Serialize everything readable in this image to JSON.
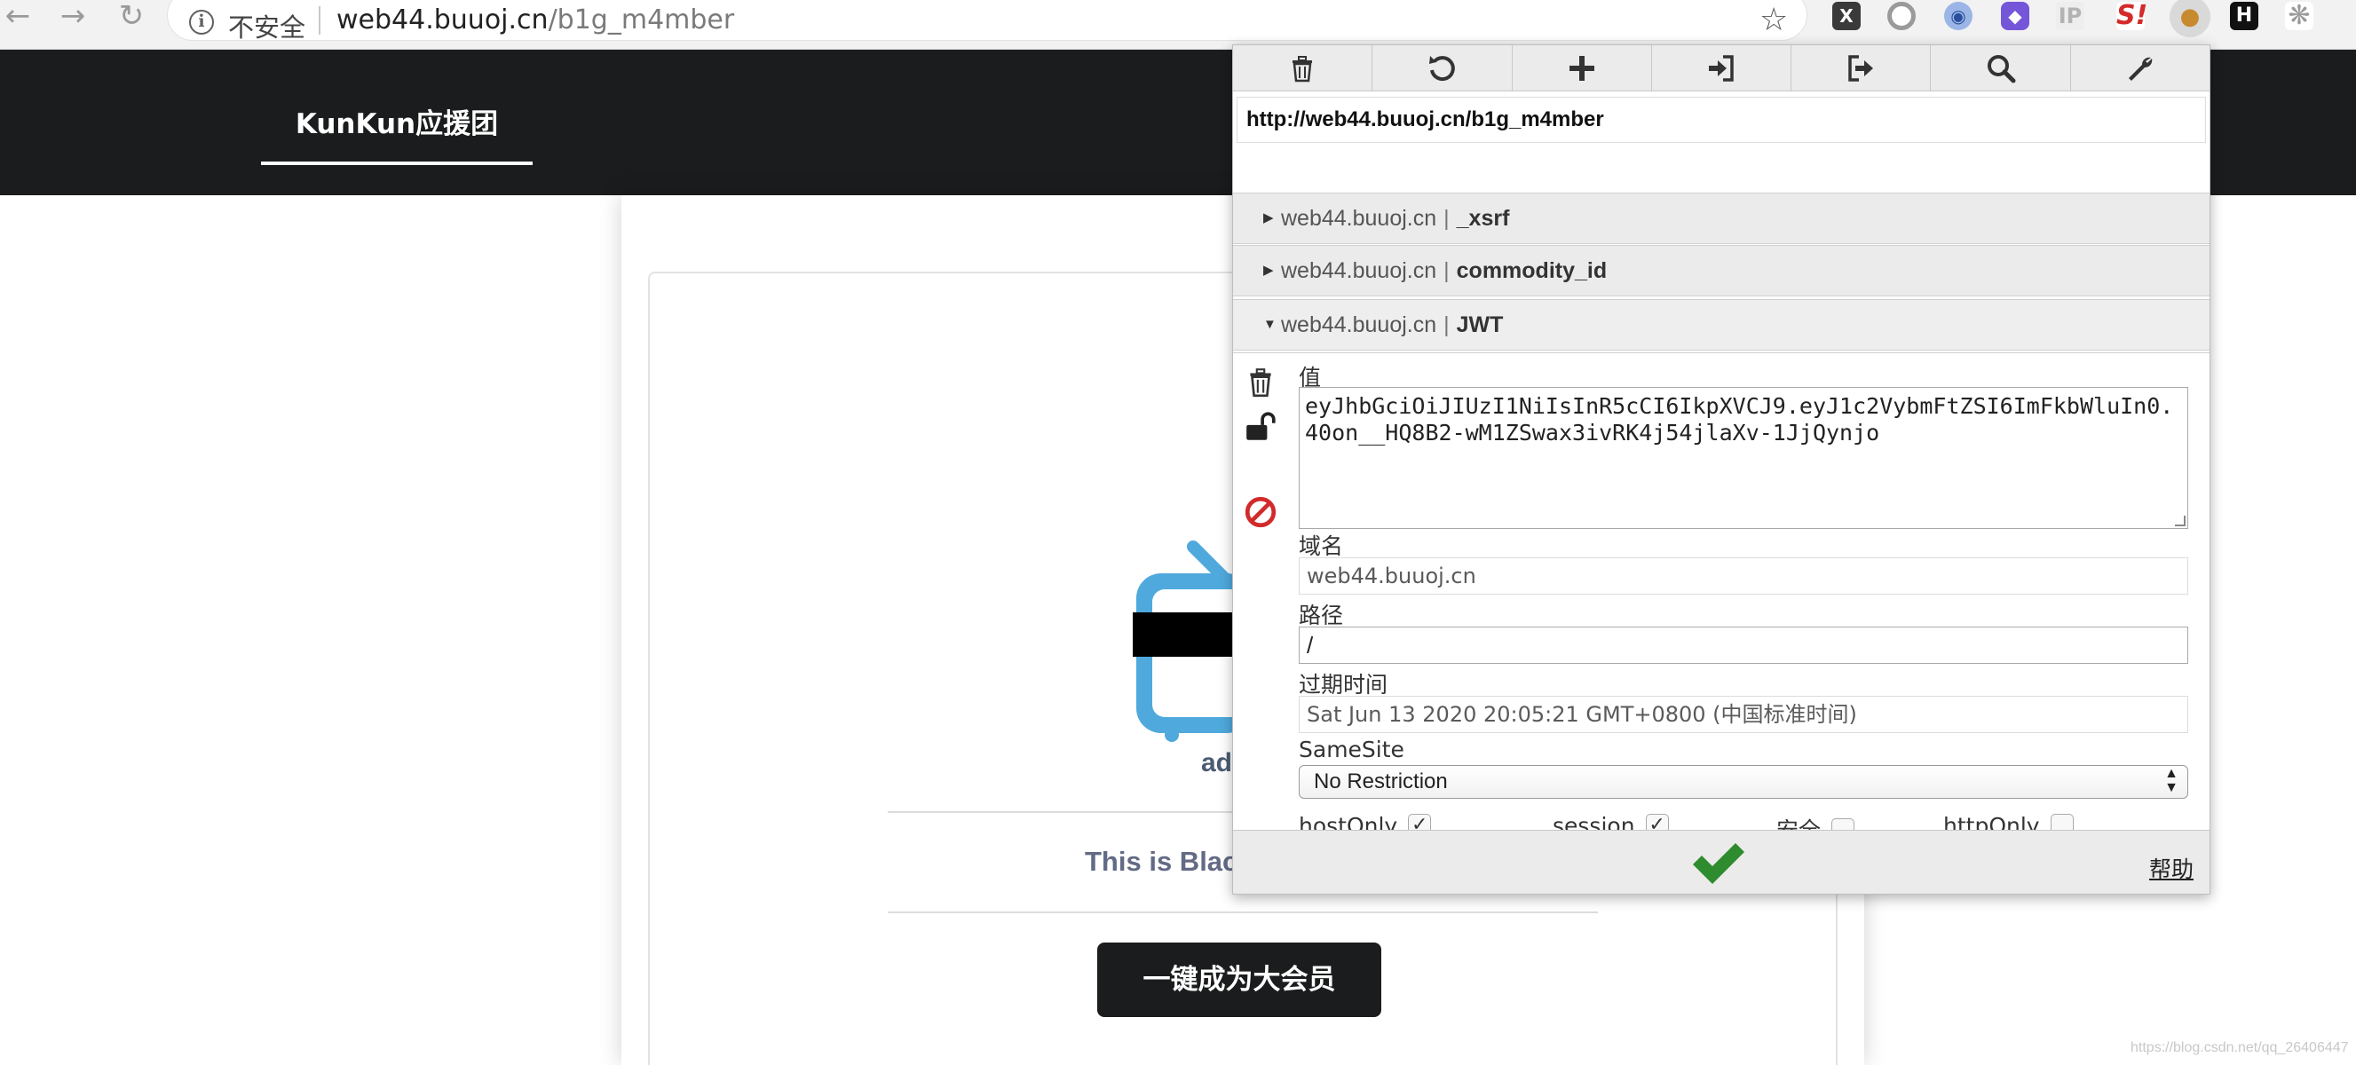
{
  "browser": {
    "back_glyph": "←",
    "forward_glyph": "→",
    "reload_glyph": "↻",
    "security_label": "不安全",
    "url_host": "web44.buuoj.cn",
    "url_path": "/b1g_m4mber",
    "bookmark_glyph": "☆",
    "extensions": [
      {
        "icon": "x-extension-icon",
        "glyph": "X"
      },
      {
        "icon": "circle-extension-icon",
        "glyph": ""
      },
      {
        "icon": "blue-swirl-extension-icon",
        "glyph": "◉"
      },
      {
        "icon": "purple-cube-extension-icon",
        "glyph": "◆"
      },
      {
        "icon": "ip-extension-icon",
        "glyph": "IP"
      },
      {
        "icon": "s-extension-icon",
        "glyph": "S!"
      },
      {
        "icon": "cookie-extension-icon",
        "glyph": "●"
      },
      {
        "icon": "h-extension-icon",
        "glyph": "H"
      },
      {
        "icon": "gear-extension-icon",
        "glyph": "❋"
      }
    ]
  },
  "site": {
    "brand": "KunKun应援团",
    "admin_text": "ad",
    "tagline": "This is Black",
    "vip_button": "一键成为大会员",
    "watermark": "https://blog.csdn.net/qq_26406447"
  },
  "cookie_editor": {
    "toolbar": [
      "delete-all-icon",
      "refresh-icon",
      "add-icon",
      "import-icon",
      "export-icon",
      "search-icon",
      "options-icon"
    ],
    "url": "http://web44.buuoj.cn/b1g_m4mber",
    "cookies": [
      {
        "domain": "web44.buuoj.cn",
        "separator": "|",
        "name": "_xsrf",
        "expanded": false,
        "arrow": "▶"
      },
      {
        "domain": "web44.buuoj.cn",
        "separator": "|",
        "name": "commodity_id",
        "expanded": false,
        "arrow": "▶"
      },
      {
        "domain": "web44.buuoj.cn",
        "separator": "|",
        "name": "JWT",
        "expanded": true,
        "arrow": "▼"
      }
    ],
    "detail": {
      "value_label": "值",
      "value": "eyJhbGciOiJIUzI1NiIsInR5cCI6IkpXVCJ9.eyJ1c2VybmFtZSI6ImFkbWluIn0.40on__HQ8B2-wM1ZSwax3ivRK4j54jlaXv-1JjQynjo",
      "domain_label": "域名",
      "domain_value": "web44.buuoj.cn",
      "path_label": "路径",
      "path_value": "/",
      "expiry_label": "过期时间",
      "expiry_value": "Sat Jun 13 2020 20:05:21 GMT+0800 (中国标准时间)",
      "samesite_label": "SameSite",
      "samesite_value": "No Restriction",
      "flags": [
        {
          "label": "hostOnly",
          "checked": true
        },
        {
          "label": "session",
          "checked": true
        },
        {
          "label": "安全",
          "checked": false
        },
        {
          "label": "httpOnly",
          "checked": false
        }
      ]
    },
    "help_label": "帮助",
    "colors": {
      "save_check": "#2e8b2e",
      "block_icon": "#d22a2a"
    }
  }
}
